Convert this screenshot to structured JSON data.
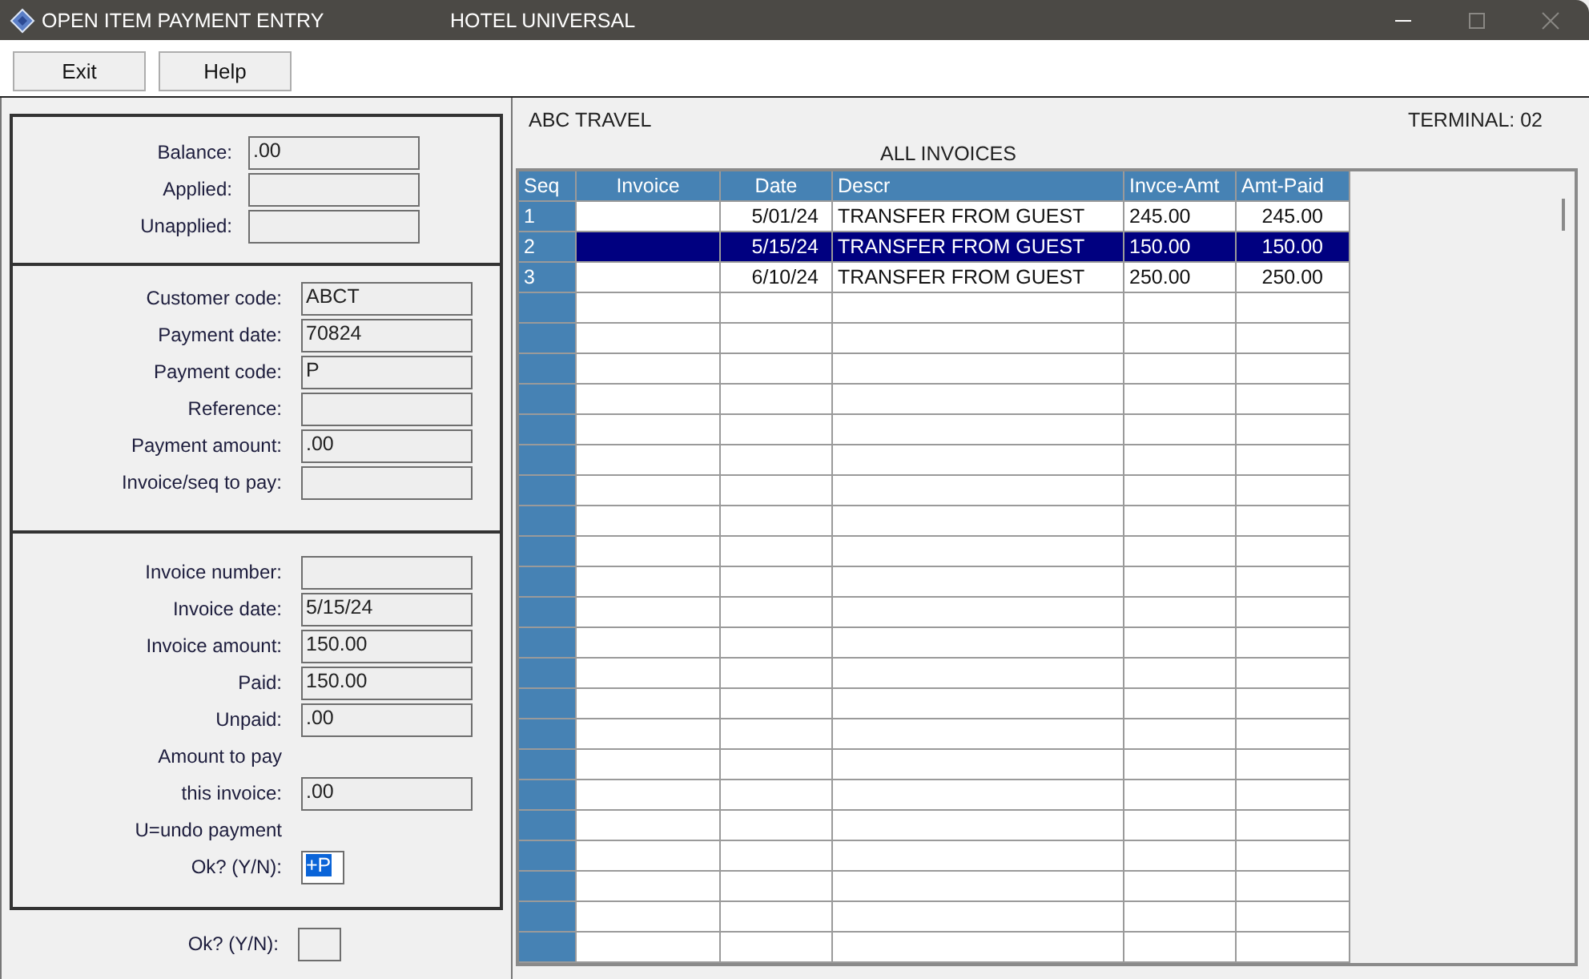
{
  "window": {
    "title": "OPEN ITEM PAYMENT ENTRY",
    "subtitle": "HOTEL UNIVERSAL"
  },
  "toolbar": [
    {
      "label": "Exit"
    },
    {
      "label": "Help"
    }
  ],
  "sections": [
    {
      "items": [
        {
          "kind": "field",
          "label": "Balance:",
          "value": ".00"
        },
        {
          "kind": "field",
          "label": "Applied:"
        },
        {
          "kind": "field",
          "label": "Unapplied:"
        }
      ]
    },
    {
      "items": [
        {
          "kind": "field",
          "label": "Customer code:",
          "value": "ABCT"
        },
        {
          "kind": "field",
          "label": "Payment date:",
          "value": "70824"
        },
        {
          "kind": "field",
          "label": "Payment code:",
          "value": "P"
        },
        {
          "kind": "field",
          "label": "Reference:"
        },
        {
          "kind": "field",
          "label": "Payment amount:",
          "value": ".00"
        },
        {
          "kind": "field",
          "label": "Invoice/seq to pay:"
        }
      ]
    },
    {
      "items": [
        {
          "kind": "field",
          "label": "Invoice number:"
        },
        {
          "kind": "field",
          "label": "Invoice date:",
          "value": "5/15/24"
        },
        {
          "kind": "field",
          "label": "Invoice amount:",
          "value": "150.00"
        },
        {
          "kind": "field",
          "label": "Paid:",
          "value": "150.00"
        },
        {
          "kind": "field",
          "label": "Unpaid:",
          "value": ".00"
        },
        {
          "kind": "note",
          "label": "Amount to pay"
        },
        {
          "kind": "field",
          "label": "this invoice:",
          "value": ".00"
        },
        {
          "kind": "note",
          "label": "U=undo payment"
        },
        {
          "kind": "small",
          "label": "Ok? (Y/N):",
          "value": "+P",
          "highlighted": true
        }
      ]
    }
  ],
  "confirm": {
    "label": "Ok? (Y/N):"
  },
  "customer": "ABC TRAVEL",
  "terminal": "TERMINAL: 02",
  "table": {
    "title": "ALL INVOICES",
    "columns": [
      "Seq",
      "Invoice",
      "Date",
      "Descr",
      "Invce-Amt",
      "Amt-Paid"
    ],
    "rows": [
      {
        "seq": "1",
        "date": "5/01/24",
        "descr": "TRANSFER FROM GUEST",
        "amount": "245.00",
        "paid": "245.00",
        "selected": false
      },
      {
        "seq": "2",
        "date": "5/15/24",
        "descr": "TRANSFER FROM GUEST",
        "amount": "150.00",
        "paid": "150.00",
        "selected": true
      },
      {
        "seq": "3",
        "date": "6/10/24",
        "descr": "TRANSFER FROM GUEST",
        "amount": "250.00",
        "paid": "250.00",
        "selected": false
      }
    ]
  }
}
